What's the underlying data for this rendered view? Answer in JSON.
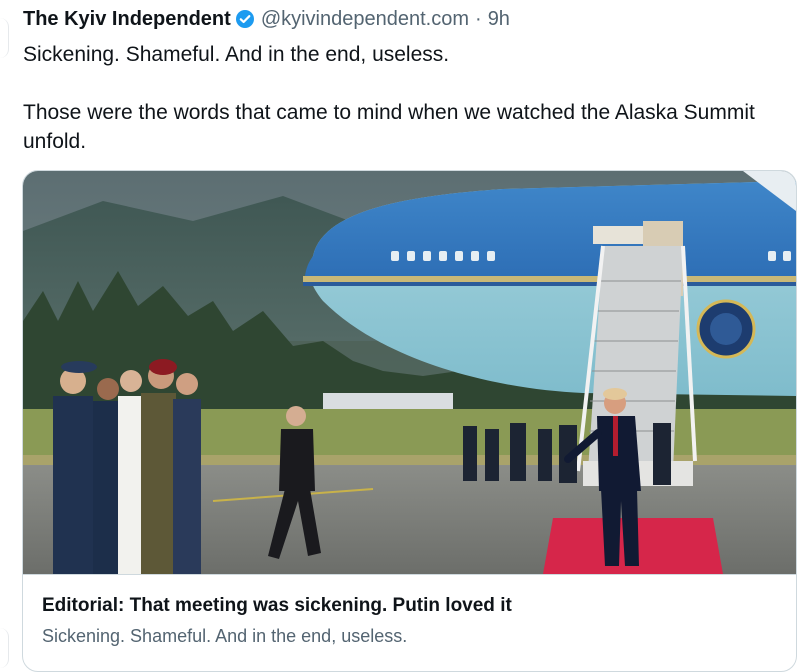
{
  "post": {
    "author_name": "The Kyiv Independent",
    "author_handle": "@kyivindependent.com",
    "separator": "·",
    "time_ago": "9h",
    "verified_icon": "verified-badge-icon",
    "text_lines": [
      "Sickening. Shameful. And in the end, useless.",
      "Those were the words that came to mind when we watched the Alaska Summit unfold."
    ]
  },
  "link_card": {
    "title": "Editorial: That meeting was sickening. Putin loved it",
    "description": "Sickening. Shameful. And in the end, useless."
  },
  "colors": {
    "text_primary": "#0f1419",
    "text_secondary": "#536471",
    "verified_blue": "#1d9bf0",
    "card_border": "#cfd9de"
  }
}
